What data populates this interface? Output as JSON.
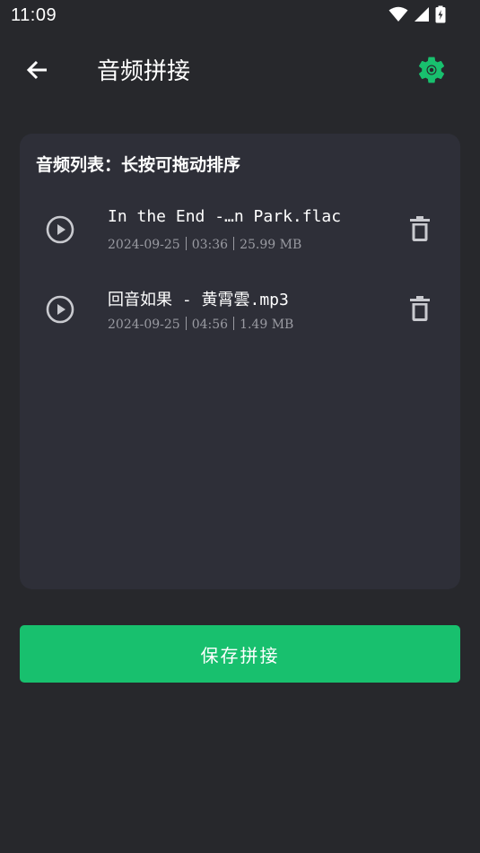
{
  "status_bar": {
    "time": "11:09",
    "icons": [
      "wifi-icon",
      "cellular-signal-icon",
      "battery-charging-icon"
    ]
  },
  "app_bar": {
    "title": "音频拼接",
    "back_icon": "arrow-left-icon",
    "settings_icon": "gear-icon"
  },
  "audio_card": {
    "title": "音频列表：长按可拖动排序",
    "items": [
      {
        "name": "In the End -…n Park.flac",
        "date": "2024-09-25",
        "duration": "03:36",
        "size": "25.99 MB"
      },
      {
        "name": "回音如果 - 黄霄雲.mp3",
        "date": "2024-09-25",
        "duration": "04:56",
        "size": "1.49 MB"
      }
    ]
  },
  "actions": {
    "save_label": "保存拼接"
  },
  "colors": {
    "background": "#27282c",
    "card": "#2e2f38",
    "accent": "#18c06e",
    "secondary_text": "#9a9ba2"
  }
}
